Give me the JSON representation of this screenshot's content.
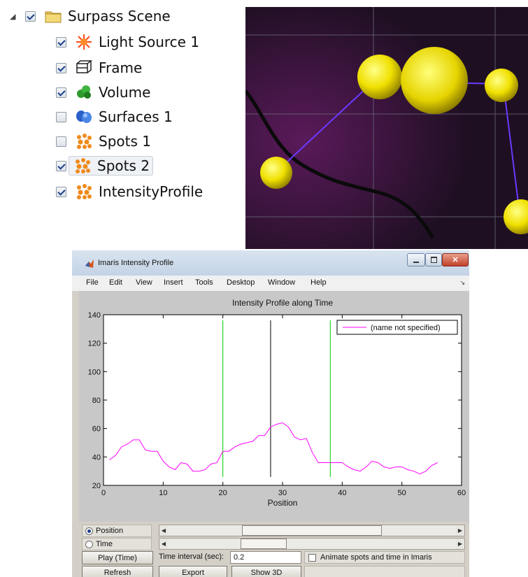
{
  "tree": {
    "items": [
      {
        "label": "Surpass Scene",
        "checked": true,
        "icon": "folder-icon",
        "root": true
      },
      {
        "label": "Light Source 1",
        "checked": true,
        "icon": "light-source-icon"
      },
      {
        "label": "Frame",
        "checked": true,
        "icon": "frame-icon"
      },
      {
        "label": "Volume",
        "checked": true,
        "icon": "volume-icon"
      },
      {
        "label": "Surfaces 1",
        "checked": false,
        "icon": "surfaces-icon"
      },
      {
        "label": "Spots 1",
        "checked": false,
        "icon": "spots-icon"
      },
      {
        "label": "Spots 2",
        "checked": true,
        "icon": "spots-icon",
        "selected": true
      },
      {
        "label": "IntensityProfile",
        "checked": true,
        "icon": "spots-icon"
      }
    ]
  },
  "window": {
    "title": "Imaris Intensity Profile",
    "menus": [
      "File",
      "Edit",
      "View",
      "Insert",
      "Tools",
      "Desktop",
      "Window",
      "Help"
    ]
  },
  "chart_data": {
    "type": "line",
    "title": "Intensity Profile along Time",
    "xlabel": "Position",
    "ylabel": "",
    "xlim": [
      0,
      60
    ],
    "ylim": [
      20,
      140
    ],
    "xticks": [
      0,
      10,
      20,
      30,
      40,
      50,
      60
    ],
    "yticks": [
      20,
      40,
      60,
      80,
      100,
      120,
      140
    ],
    "grid": false,
    "legend": {
      "placement": "top-right",
      "entries": [
        "(name not specified)"
      ]
    },
    "series": [
      {
        "name": "(name not specified)",
        "color": "#ff00ff",
        "x": [
          1,
          2,
          3,
          4,
          5,
          6,
          7,
          8,
          9,
          10,
          11,
          12,
          13,
          14,
          15,
          16,
          17,
          18,
          19,
          20,
          21,
          22,
          23,
          24,
          25,
          26,
          27,
          28,
          29,
          30,
          31,
          32,
          33,
          34,
          35,
          36,
          37,
          38,
          39,
          40,
          41,
          42,
          43,
          44,
          45,
          46,
          47,
          48,
          49,
          50,
          51,
          52,
          53,
          54,
          55,
          56
        ],
        "y": [
          38,
          41,
          47,
          49,
          52,
          52,
          45,
          44,
          44,
          37,
          33,
          31,
          36,
          35,
          30,
          30,
          31,
          35,
          36,
          44,
          44,
          47,
          49,
          50,
          51,
          55,
          55,
          61,
          63,
          64,
          61,
          54,
          52,
          53,
          43,
          36,
          36,
          36,
          36,
          36,
          33,
          31,
          30,
          33,
          37,
          36,
          33,
          32,
          33,
          33,
          31,
          30,
          28,
          30,
          34,
          36
        ]
      }
    ],
    "vertical_lines": [
      {
        "x": 20,
        "color": "#00cc00"
      },
      {
        "x": 28,
        "color": "#000000"
      },
      {
        "x": 38,
        "color": "#00cc00"
      }
    ]
  },
  "controls": {
    "radio_position": "Position",
    "radio_time": "Time",
    "position_value": 0.5,
    "time_value": 0.3,
    "play_button": "Play (Time)",
    "interval_label": "Time interval (sec):",
    "interval_value": "0.2",
    "animate_label": "Animate spots and time in Imaris",
    "animate_checked": false,
    "refresh_button": "Refresh",
    "export_button": "Export",
    "show3d_button": "Show 3D"
  }
}
